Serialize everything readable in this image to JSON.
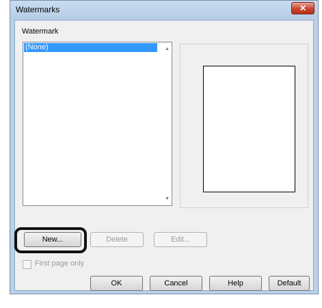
{
  "window": {
    "title": "Watermarks",
    "close_icon": "close-icon"
  },
  "watermark_section": {
    "label": "Watermark"
  },
  "list": {
    "items": [
      "(None)"
    ],
    "selected": "(None)"
  },
  "buttons": {
    "new": "New...",
    "delete": "Delete",
    "edit": "Edit..."
  },
  "first_page_only": {
    "label": "First page only",
    "checked": false
  },
  "footer": {
    "ok": "OK",
    "cancel": "Cancel",
    "help": "Help",
    "default": "Default"
  },
  "colors": {
    "selection": "#3399ff",
    "close_button": "#c7452f",
    "highlight_ring": "#111111"
  }
}
